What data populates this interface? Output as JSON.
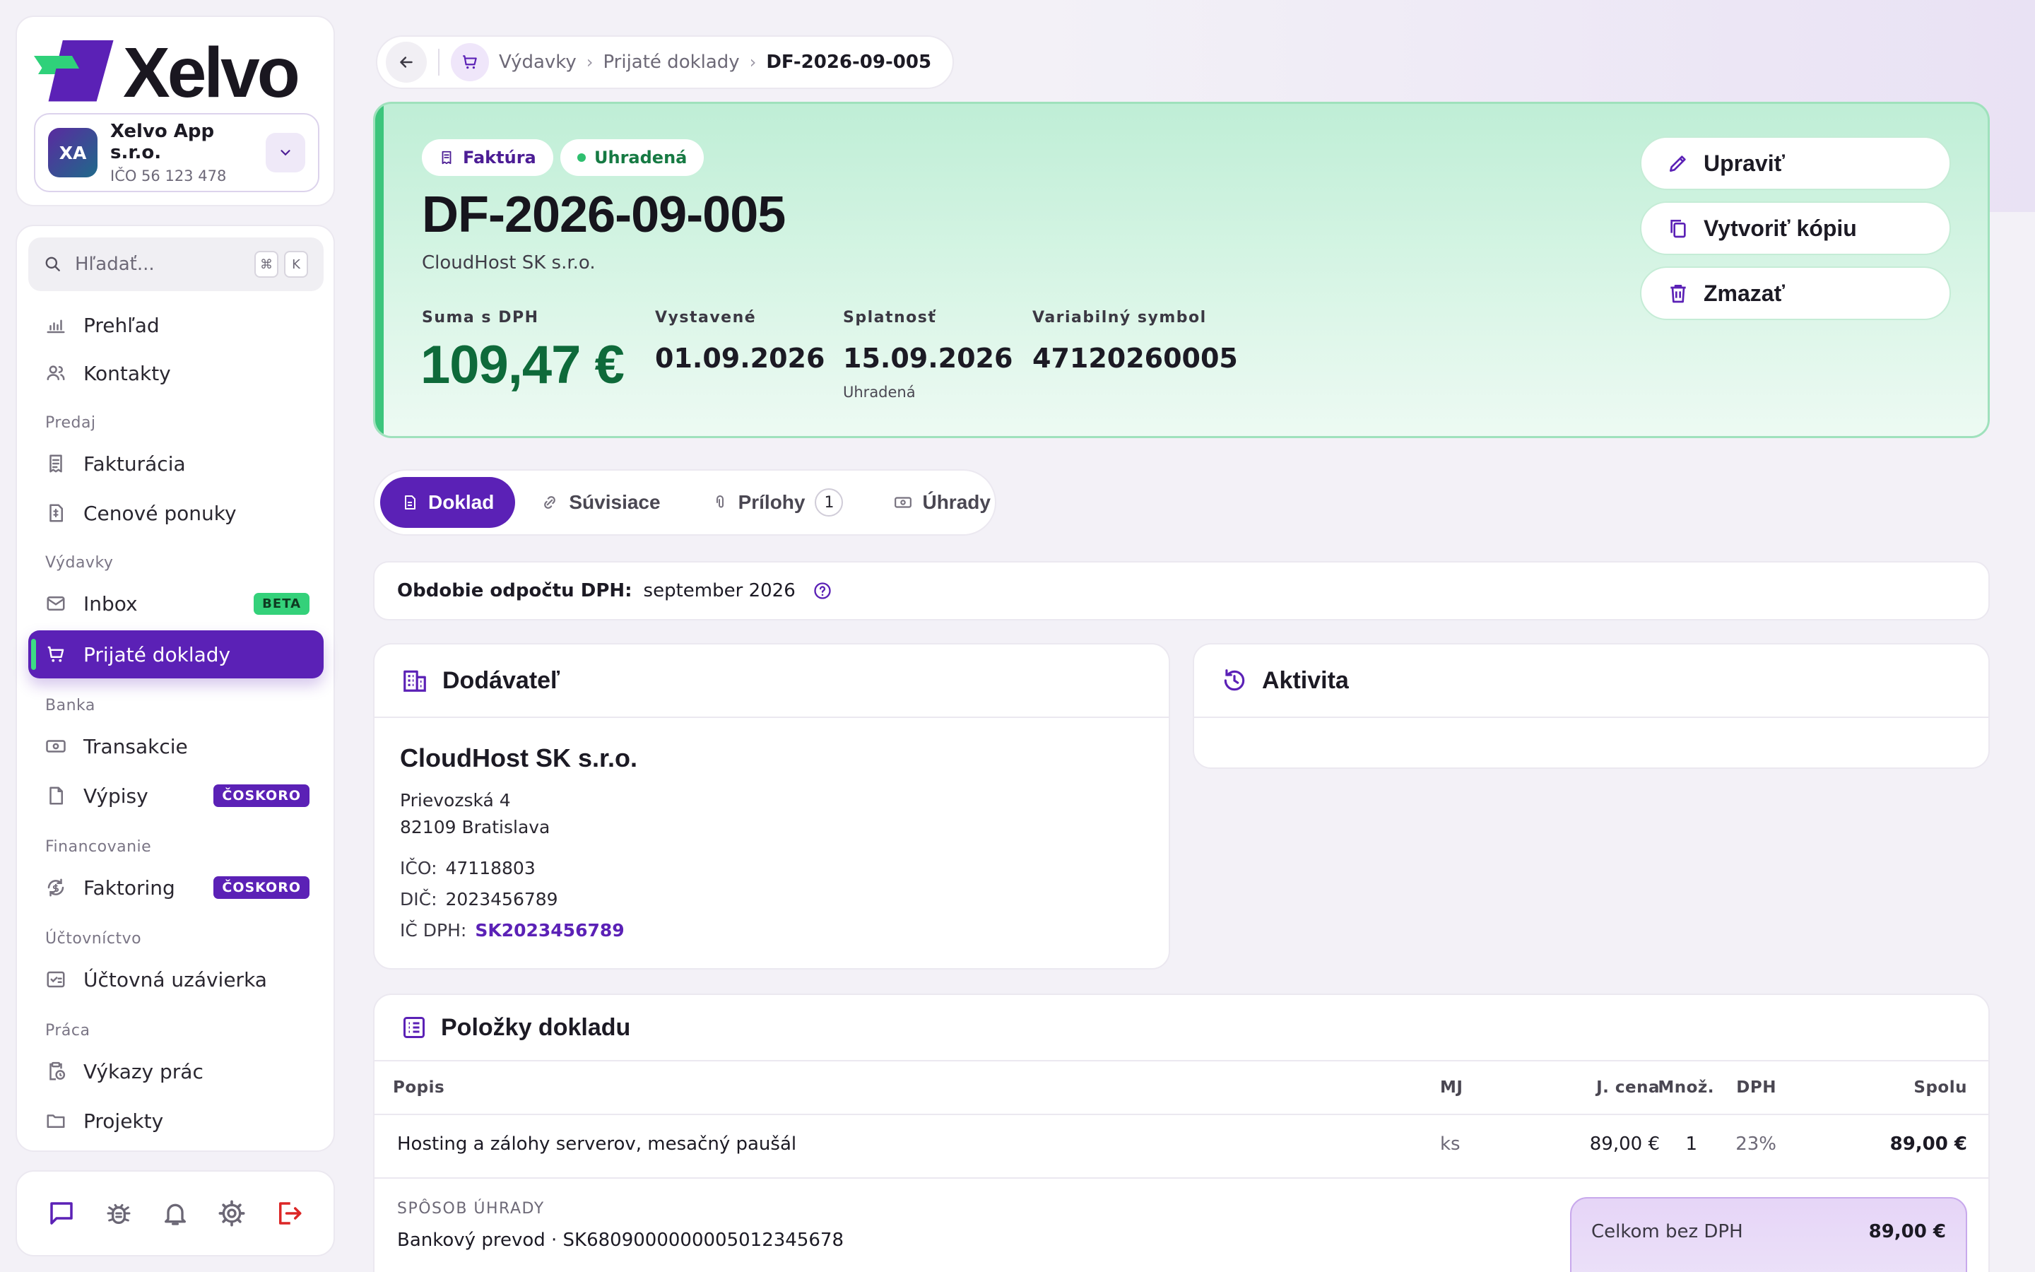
{
  "app": {
    "name": "Xelvo"
  },
  "org": {
    "initials": "XA",
    "name": "Xelvo App s.r.o.",
    "ico": "IČO 56 123 478"
  },
  "search": {
    "placeholder": "Hľadať...",
    "kbd1": "⌘",
    "kbd2": "K"
  },
  "nav": {
    "overview": "Prehľad",
    "contacts": "Kontakty",
    "sec_sales": "Predaj",
    "invoicing": "Fakturácia",
    "quotes": "Cenové ponuky",
    "sec_expenses": "Výdavky",
    "inbox": "Inbox",
    "inbox_badge": "BETA",
    "received": "Prijaté doklady",
    "sec_bank": "Banka",
    "transactions": "Transakcie",
    "statements": "Výpisy",
    "statements_badge": "ČOSKORO",
    "sec_financing": "Financovanie",
    "factoring": "Faktoring",
    "factoring_badge": "ČOSKORO",
    "sec_accounting": "Účtovníctvo",
    "closing": "Účtovná uzávierka",
    "sec_work": "Práca",
    "timesheets": "Výkazy prác",
    "projects": "Projekty"
  },
  "breadcrumb": {
    "items": [
      "Výdavky",
      "Prijaté doklady"
    ],
    "current": "DF-2026-09-005"
  },
  "document": {
    "type_badge": "Faktúra",
    "status_badge": "Uhradená",
    "number": "DF-2026-09-005",
    "vendor": "CloudHost SK s.r.o.",
    "sum_label": "Suma s DPH",
    "sum_value": "109,47 €",
    "issued_label": "Vystavené",
    "issued_value": "01.09.2026",
    "due_label": "Splatnosť",
    "due_value": "15.09.2026",
    "due_sub": "Uhradená",
    "vs_label": "Variabilný symbol",
    "vs_value": "47120260005"
  },
  "actions": {
    "edit": "Upraviť",
    "copy": "Vytvoriť kópiu",
    "delete": "Zmazať"
  },
  "tabs": {
    "doc": "Doklad",
    "related": "Súvisiace",
    "attachments": "Prílohy",
    "attachments_count": "1",
    "payments": "Úhrady"
  },
  "vat_period": {
    "label": "Obdobie odpočtu DPH:",
    "value": "september 2026"
  },
  "supplier": {
    "heading": "Dodávateľ",
    "name": "CloudHost SK s.r.o.",
    "street": "Prievozská 4",
    "city": "82109 Bratislava",
    "ico_label": "IČO:",
    "ico": "47118803",
    "dic_label": "DIČ:",
    "dic": "2023456789",
    "icdph_label": "IČ DPH:",
    "icdph": "SK2023456789"
  },
  "activity": {
    "heading": "Aktivita"
  },
  "items": {
    "heading": "Položky dokladu",
    "columns": {
      "desc": "Popis",
      "qty": "Množ.",
      "unit": "MJ",
      "price": "J. cena",
      "vat": "DPH",
      "total": "Spolu"
    },
    "rows": [
      {
        "desc": "Hosting a zálohy serverov, mesačný paušál",
        "qty": "1",
        "unit": "ks",
        "price": "89,00 €",
        "vat": "23%",
        "total": "89,00 €"
      }
    ],
    "payment_label": "SPÔSOB ÚHRADY",
    "payment_value": "Bankový prevod · SK6809000000005012345678",
    "subtotal_label": "Celkom bez DPH",
    "subtotal_value": "89,00 €"
  },
  "colors": {
    "accent": "#5b21b6",
    "success": "#2fbf6f",
    "hero_bg": "#c8f1dd",
    "logo_green": "#2fd17a"
  }
}
